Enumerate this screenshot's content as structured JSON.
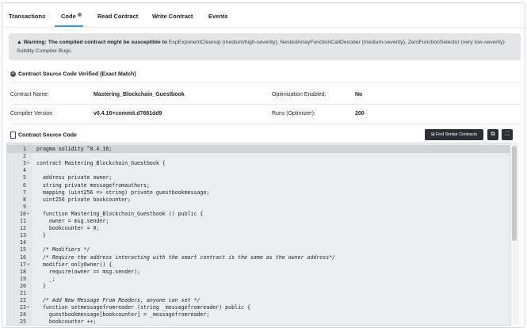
{
  "tabs": [
    {
      "label": "Transactions"
    },
    {
      "label": "Code"
    },
    {
      "label": "Read Contract"
    },
    {
      "label": "Write Contract"
    },
    {
      "label": "Events"
    }
  ],
  "warning": {
    "prefix": "Warning:",
    "bold": "The compiled contract might be susceptible to",
    "text": "ExpExponentCleanup (medium/high-severity), NestedArrayFunctionCallDecoder (medium-severity), ZeroFunctionSelector (very low-severity) Solidity Compiler Bugs."
  },
  "verified_label": "Contract Source Code Verified (Exact Match)",
  "details": {
    "contract_name_label": "Contract Name:",
    "contract_name": "Mastering_Blockchain_Guestbook",
    "optimization_label": "Optimization Enabled:",
    "optimization": "No",
    "compiler_label": "Compiler Version",
    "compiler": "v0.4.16+commit.d7661dd9",
    "runs_label": "Runs (Optimizer):",
    "runs": "200"
  },
  "source": {
    "title": "Contract Source Code",
    "find_button": "Find Similar Contracts",
    "copy_icon": "copy-icon",
    "expand_icon": "expand-icon"
  },
  "code_lines": [
    {
      "n": "1",
      "fold": "",
      "text": "pragma solidity ^0.4.16;"
    },
    {
      "n": "2",
      "fold": "",
      "text": ""
    },
    {
      "n": "3",
      "fold": "▾",
      "text": "contract Mastering_Blockchain_Guestbook {"
    },
    {
      "n": "4",
      "fold": "",
      "text": ""
    },
    {
      "n": "5",
      "fold": "",
      "text": "  address private owner;"
    },
    {
      "n": "6",
      "fold": "",
      "text": "  string private messagefromauthors;"
    },
    {
      "n": "7",
      "fold": "",
      "text": "  mapping (uint256 => string) private guestbookmessage;"
    },
    {
      "n": "8",
      "fold": "",
      "text": "  uint256 private bookcounter;"
    },
    {
      "n": "9",
      "fold": "",
      "text": ""
    },
    {
      "n": "10",
      "fold": "▾",
      "text": "  function Mastering_Blockchain_Guestbook () public {"
    },
    {
      "n": "11",
      "fold": "",
      "text": "    owner = msg.sender;"
    },
    {
      "n": "12",
      "fold": "",
      "text": "    bookcounter = 0;"
    },
    {
      "n": "13",
      "fold": "",
      "text": "  }"
    },
    {
      "n": "14",
      "fold": "",
      "text": ""
    },
    {
      "n": "15",
      "fold": "",
      "text": "  /* Modifiers */",
      "comment": true
    },
    {
      "n": "16",
      "fold": "",
      "text": "  /* Require the address interacting with the smart contract is the same as the owner address*/",
      "comment": true
    },
    {
      "n": "17",
      "fold": "▾",
      "text": "  modifier onlyOwner() {"
    },
    {
      "n": "18",
      "fold": "",
      "text": "    require(owner == msg.sender);"
    },
    {
      "n": "19",
      "fold": "",
      "text": "    _;"
    },
    {
      "n": "20",
      "fold": "",
      "text": "  }"
    },
    {
      "n": "21",
      "fold": "",
      "text": ""
    },
    {
      "n": "22",
      "fold": "",
      "text": "  /* Add New Message From Readers, anyone can set */",
      "comment": true
    },
    {
      "n": "23",
      "fold": "▾",
      "text": "  function setmessagefromreader (string _messagefromreader) public {"
    },
    {
      "n": "24",
      "fold": "",
      "text": "    guestbookmessage[bookcounter] = _messagefromreader;"
    },
    {
      "n": "25",
      "fold": "",
      "text": "    bookcounter ++;"
    }
  ]
}
